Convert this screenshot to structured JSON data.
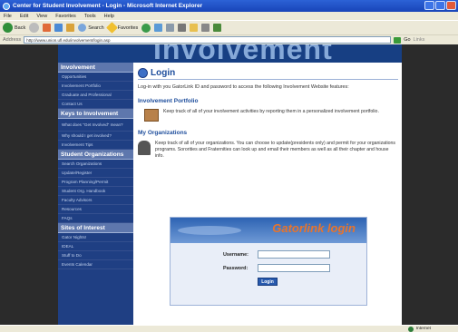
{
  "window": {
    "title": "Center for Student Involvement - Login - Microsoft Internet Explorer"
  },
  "menubar": {
    "items": [
      "File",
      "Edit",
      "View",
      "Favorites",
      "Tools",
      "Help"
    ]
  },
  "toolbar": {
    "back_label": "Back",
    "search_label": "Search",
    "favorites_label": "Favorites"
  },
  "addressbar": {
    "label": "Address",
    "url": "http://www.union.ufl.edu/involvement/login.asp",
    "go_label": "Go",
    "links_label": "Links"
  },
  "banner": {
    "text": "Involvement"
  },
  "sidebar": {
    "sections": [
      {
        "heading": "Involvement",
        "items": [
          "Opportunities",
          "Involvement Portfolio",
          "Graduate and Professional",
          "Contact Us"
        ]
      },
      {
        "heading": "Keys to Involvement",
        "items": [
          "What does \"Get Involved\" mean?",
          "Why should I get involved?",
          "Involvement Tips"
        ]
      },
      {
        "heading": "Student Organizations",
        "items": [
          "Search Organizations",
          "Update/Register",
          "Program Planning/Permit",
          "Student Org. Handbook",
          "Faculty Advisors",
          "Resources",
          "FAQs"
        ]
      },
      {
        "heading": "Sites of Interest",
        "items": [
          "Gator Nights!",
          "IDEAL",
          "Stuff to Do",
          "Events Calendar"
        ]
      }
    ]
  },
  "main": {
    "title": "Login",
    "intro": "Log-in with you GatorLink ID and password to access the following Involvement Website features:",
    "features": [
      {
        "title": "Involvement Portfolio",
        "text": "Keep track of all of your involvement activities by reporting them in a personalized involvement portfolio."
      },
      {
        "title": "My Organizations",
        "text": "Keep track of all of your organizations. You can choose to update(presidents only) and permit for your organizations programs. Sororities and Fraternities can look up and email their members as well as all their chapter and house info."
      }
    ],
    "login_box": {
      "title": "Gatorlink login",
      "username_label": "Username:",
      "password_label": "Password:",
      "button_label": "Login"
    }
  },
  "statusbar": {
    "zone_label": "Internet"
  }
}
